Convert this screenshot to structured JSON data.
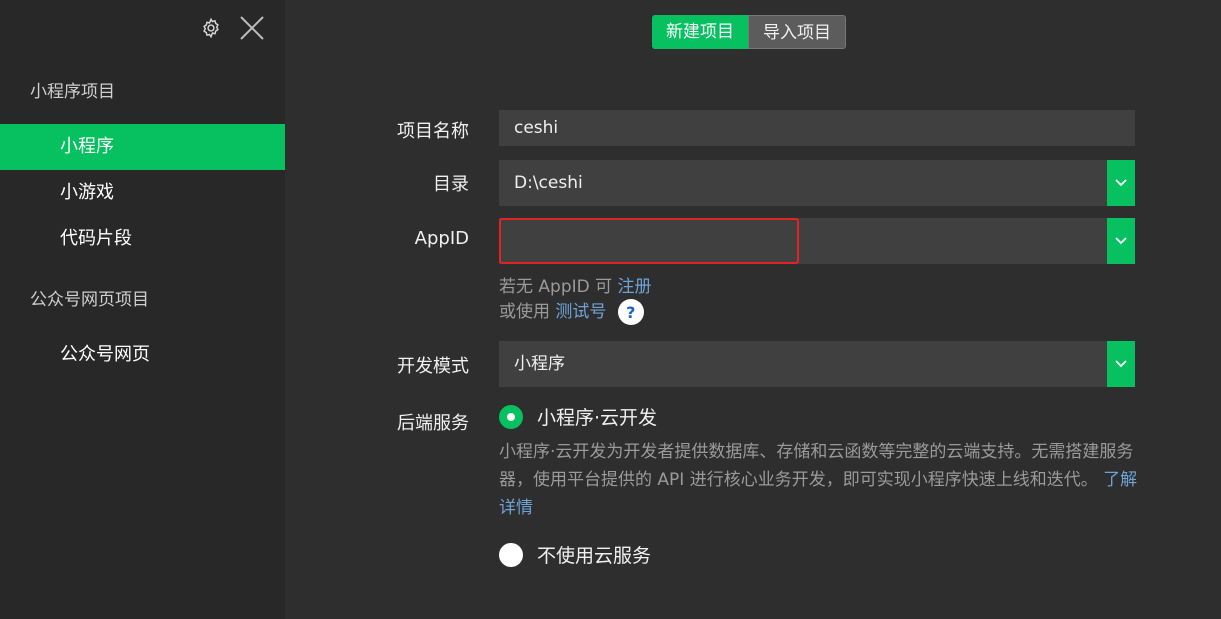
{
  "sidebar": {
    "groups": [
      {
        "title": "小程序项目",
        "items": [
          "小程序",
          "小游戏",
          "代码片段"
        ]
      },
      {
        "title": "公众号网页项目",
        "items": [
          "公众号网页"
        ]
      }
    ],
    "active_item": "小程序",
    "icons": [
      "gear-icon",
      "close-icon"
    ]
  },
  "tabs": {
    "new_project": "新建项目",
    "import_project": "导入项目"
  },
  "form": {
    "name_label": "项目名称",
    "name_value": "ceshi",
    "dir_label": "目录",
    "dir_value": "D:\\ceshi",
    "appid_label": "AppID",
    "appid_value": "",
    "appid_hint_prefix": "若无 AppID 可",
    "appid_hint_link": "注册",
    "test_prefix": "或使用",
    "test_link": "测试号",
    "help_symbol": "?",
    "mode_label": "开发模式",
    "mode_value": "小程序",
    "backend_label": "后端服务",
    "cloud_option": "小程序·云开发",
    "cloud_desc": "小程序·云开发为开发者提供数据库、存储和云函数等完整的云端支持。无需搭建服务器，使用平台提供的 API 进行核心业务开发，即可实现小程序快速上线和迭代。",
    "cloud_link": "了解详情",
    "no_cloud_option": "不使用云服务"
  },
  "colors": {
    "accent": "#07c160",
    "error": "#e02424",
    "link": "#6ea3d6"
  }
}
